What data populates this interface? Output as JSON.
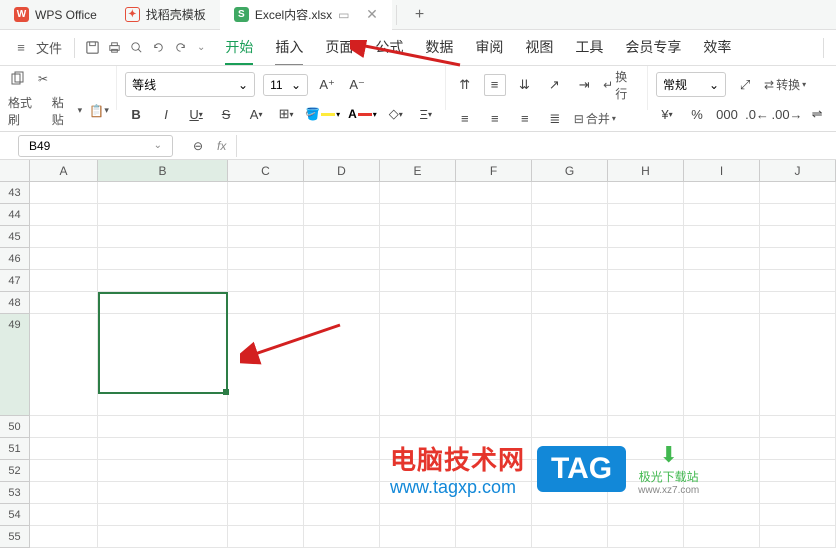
{
  "tabs": {
    "t1": "WPS Office",
    "t2": "找稻壳模板",
    "t3": "Excel内容.xlsx",
    "add": "+"
  },
  "menu": {
    "file": "文件",
    "start": "开始",
    "insert": "插入",
    "page": "页面",
    "formula": "公式",
    "data": "数据",
    "review": "审阅",
    "view": "视图",
    "tools": "工具",
    "member": "会员专享",
    "eff": "效率"
  },
  "tb": {
    "format": "格式刷",
    "paste": "粘贴",
    "font": "等线",
    "size": "11",
    "wrap": "换行",
    "merge": "合并",
    "normal": "常规",
    "convert": "转换"
  },
  "namebox": {
    "cell": "B49",
    "fx": "fx"
  },
  "cols": {
    "A": "A",
    "B": "B",
    "C": "C",
    "D": "D",
    "E": "E",
    "F": "F",
    "G": "G",
    "H": "H",
    "I": "I",
    "J": "J"
  },
  "rows": [
    "43",
    "44",
    "45",
    "46",
    "47",
    "48",
    "49",
    "50",
    "51",
    "52",
    "53",
    "54",
    "55"
  ],
  "wm": {
    "t1": "电脑技术网",
    "t2": "www.tagxp.com",
    "tag": "TAG",
    "dl1": "极光下载站",
    "dl2": "www.xz7.com"
  }
}
